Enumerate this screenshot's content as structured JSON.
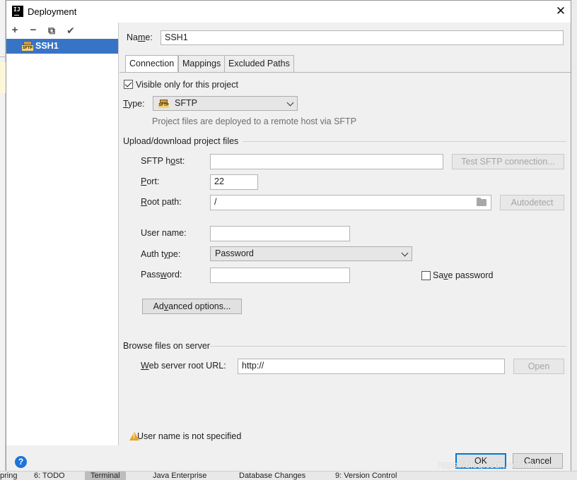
{
  "ide": {
    "bottom_tabs": [
      "pring",
      "6: TODO",
      "Terminal",
      "Java Enterprise",
      "Database Changes",
      "9: Version Control"
    ]
  },
  "dialog": {
    "title": "Deployment",
    "close_glyph": "✕"
  },
  "toolbar": {
    "add": "+",
    "remove": "−",
    "copy": "⧉",
    "apply": "✔"
  },
  "servers": [
    {
      "name": "SSH1",
      "icon": "sftp-server-icon",
      "selected": true
    }
  ],
  "name": {
    "label_pre": "Na",
    "label_u": "m",
    "label_post": "e:",
    "value": "SSH1"
  },
  "tabs": [
    {
      "label": "Connection",
      "selected": true
    },
    {
      "label": "Mappings",
      "selected": false
    },
    {
      "label": "Excluded Paths",
      "selected": false
    }
  ],
  "connection": {
    "visible_only": {
      "label": "Visible only for this project",
      "checked": true
    },
    "type": {
      "label_u": "T",
      "label_post": "ype:",
      "value": "SFTP",
      "badge": "SFTP"
    },
    "type_desc": "Project files are deployed to a remote host via SFTP",
    "upload_section": "Upload/download project files",
    "sftp_host": {
      "label_pre": "SFTP h",
      "label_u": "o",
      "label_post": "st:",
      "value": ""
    },
    "test_button": "Test SFTP connection...",
    "port": {
      "label_u": "P",
      "label_post": "ort:",
      "value": "22"
    },
    "root_path": {
      "label_u": "R",
      "label_post": "oot path:",
      "value": "/"
    },
    "autodetect_button": "Autodetect",
    "user_name": {
      "label_pre": "User name:",
      "value": ""
    },
    "auth_type": {
      "label_pre": "Auth t",
      "label_u": "y",
      "label_post": "pe:",
      "value": "Password"
    },
    "password": {
      "label_pre": "Pass",
      "label_u": "w",
      "label_post": "ord:",
      "value": ""
    },
    "save_password": {
      "label_pre": "Sa",
      "label_u": "v",
      "label_post": "e password",
      "checked": false
    },
    "advanced_button": {
      "label_pre": "Ad",
      "label_u": "v",
      "label_post": "anced options..."
    },
    "browse_section": "Browse files on server",
    "web_root": {
      "label_u": "W",
      "label_post": "eb server root URL:",
      "value": "http://"
    },
    "open_button": "Open"
  },
  "status": {
    "warning": "User name is not specified"
  },
  "buttons": {
    "help": "?",
    "ok": "OK",
    "cancel": "Cancel"
  },
  "watermark": "https://blog.csdn.net/taiuli",
  "colors": {
    "selection": "#3874c5",
    "help_blue": "#1e74d7",
    "warning": "#e8a420",
    "default_button_border": "#0078d7"
  }
}
